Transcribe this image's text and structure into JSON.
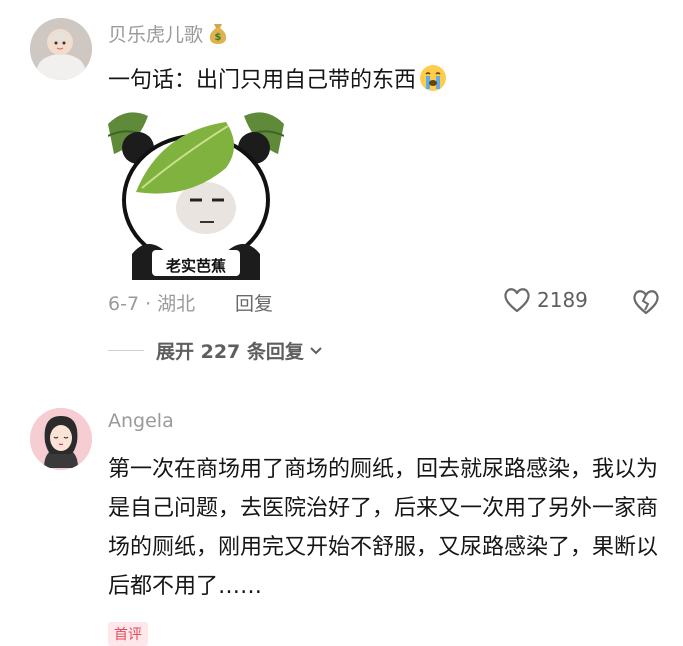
{
  "comments": [
    {
      "username": "贝乐虎儿歌",
      "badge_icon": "money-bag-icon",
      "text": "一句话：出门只用自己带的东西",
      "emoji_icon": "crying-face-icon",
      "sticker_caption": "老实芭蕉",
      "date_location": "6-7 · 湖北",
      "reply_label": "回复",
      "like_count": "2189",
      "expand_replies_label": "展开 227 条回复"
    },
    {
      "username": "Angela",
      "text": "第一次在商场用了商场的厕纸，回去就尿路感染，我以为是自己问题，去医院治好了，后来又一次用了另外一家商场的厕纸，刚用完又开始不舒服，又尿路感染了，果断以后都不用了……",
      "badge_label": "首评"
    }
  ],
  "colors": {
    "meta_gray": "#9a9a9a",
    "text_dark": "#161616",
    "badge_red": "#e64a5d"
  }
}
